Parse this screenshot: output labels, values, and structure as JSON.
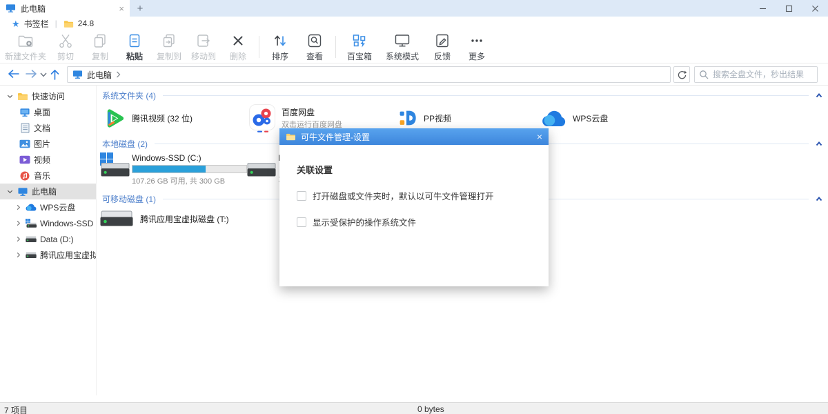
{
  "tab": {
    "title": "此电脑",
    "close_glyph": "×",
    "new_tab_glyph": "+"
  },
  "bookmarks": {
    "bar_label": "书签栏",
    "separator": "|",
    "folder_label": "24.8"
  },
  "toolbar": {
    "buttons": [
      {
        "label": "新建文件夹",
        "enabled": false
      },
      {
        "label": "剪切",
        "enabled": false
      },
      {
        "label": "复制",
        "enabled": false
      },
      {
        "label": "粘贴",
        "enabled": true
      },
      {
        "label": "复制到",
        "enabled": false
      },
      {
        "label": "移动到",
        "enabled": false
      },
      {
        "label": "删除",
        "enabled": false
      },
      {
        "label": "排序",
        "enabled": true
      },
      {
        "label": "查看",
        "enabled": true
      },
      {
        "label": "百宝箱",
        "enabled": true
      },
      {
        "label": "系统模式",
        "enabled": true
      },
      {
        "label": "反馈",
        "enabled": true
      },
      {
        "label": "更多",
        "enabled": true
      }
    ]
  },
  "address": {
    "location": "此电脑"
  },
  "search": {
    "placeholder": "搜索全盘文件，秒出结果"
  },
  "sidebar": {
    "groups": [
      {
        "label": "快速访问",
        "expanded": true,
        "items": [
          {
            "label": "桌面"
          },
          {
            "label": "文档"
          },
          {
            "label": "图片"
          },
          {
            "label": "视频"
          },
          {
            "label": "音乐"
          }
        ]
      },
      {
        "label": "此电脑",
        "expanded": true,
        "selected": true,
        "items": [
          {
            "label": "WPS云盘"
          },
          {
            "label": "Windows-SSD (C:)"
          },
          {
            "label": "Data (D:)"
          },
          {
            "label": "腾讯应用宝虚拟磁盘 (T:)"
          }
        ]
      }
    ]
  },
  "content": {
    "sections": [
      {
        "title": "系统文件夹 (4)",
        "items": [
          {
            "name": "腾讯视频 (32 位)"
          },
          {
            "name": "百度网盘",
            "subtitle": "双击运行百度网盘"
          },
          {
            "name": "PP视频"
          },
          {
            "name": "WPS云盘"
          }
        ]
      },
      {
        "title": "本地磁盘 (2)",
        "items": [
          {
            "name": "Windows-SSD (C:)",
            "capacity": "107.26 GB 可用, 共 300 GB",
            "used_percent": 64,
            "bar_style": "width:64%"
          },
          {
            "name": "Data (D:)",
            "capacity_visible": "11"
          }
        ]
      },
      {
        "title": "可移动磁盘 (1)",
        "items": [
          {
            "name": "腾讯应用宝虚拟磁盘 (T:)"
          }
        ]
      }
    ]
  },
  "dialog": {
    "title": "可牛文件管理-设置",
    "close_glyph": "×",
    "section_title": "关联设置",
    "checkboxes": [
      {
        "label": "打开磁盘或文件夹时，默认以可牛文件管理打开",
        "checked": false
      },
      {
        "label": "显示受保护的操作系统文件",
        "checked": false
      }
    ]
  },
  "statusbar": {
    "items_count": "7 项目",
    "total_size": "0 bytes"
  }
}
